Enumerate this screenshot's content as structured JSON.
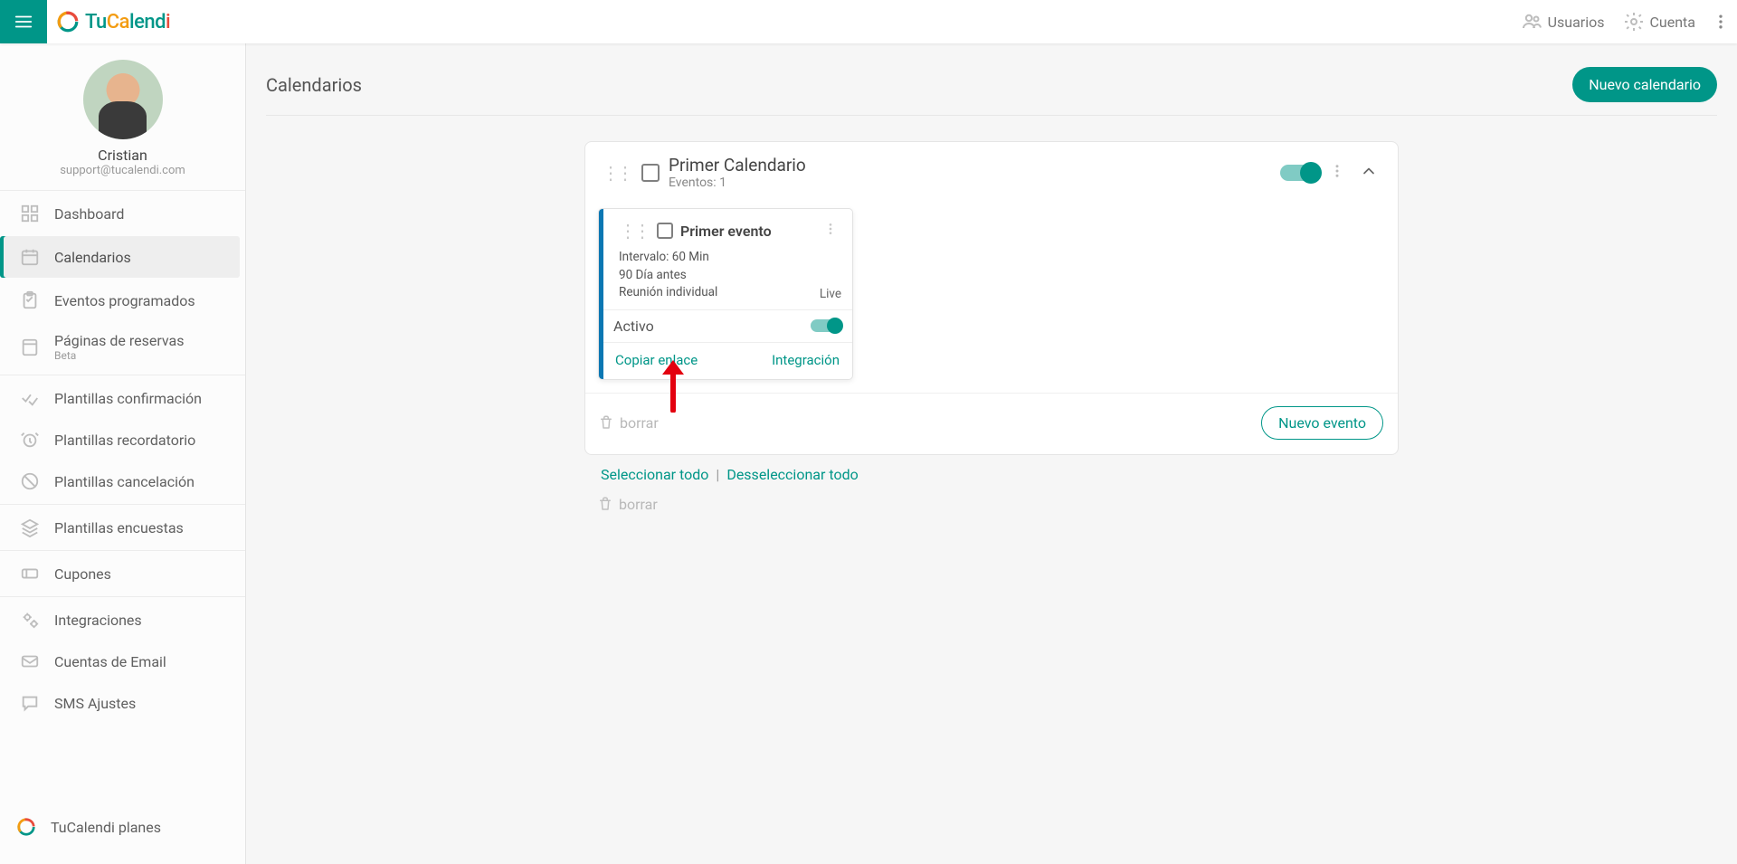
{
  "brand": {
    "p1": "Tu",
    "p2": "Ca",
    "p3": "lend",
    "p4": "i"
  },
  "header": {
    "users": "Usuarios",
    "account": "Cuenta"
  },
  "profile": {
    "name": "Cristian",
    "email": "support@tucalendi.com"
  },
  "sidebar": {
    "items": [
      {
        "id": "dashboard",
        "label": "Dashboard"
      },
      {
        "id": "calendarios",
        "label": "Calendarios"
      },
      {
        "id": "eventos",
        "label": "Eventos programados"
      },
      {
        "id": "reservas",
        "label": "Páginas de reservas",
        "sub": "Beta"
      },
      {
        "id": "tconf",
        "label": "Plantillas confirmación"
      },
      {
        "id": "trec",
        "label": "Plantillas recordatorio"
      },
      {
        "id": "tcan",
        "label": "Plantillas cancelación"
      },
      {
        "id": "tenc",
        "label": "Plantillas encuestas"
      },
      {
        "id": "cupones",
        "label": "Cupones"
      },
      {
        "id": "integr",
        "label": "Integraciones"
      },
      {
        "id": "email",
        "label": "Cuentas de Email"
      },
      {
        "id": "sms",
        "label": "SMS Ajustes"
      }
    ],
    "bottom": {
      "label": "TuCalendi planes"
    }
  },
  "page": {
    "title": "Calendarios",
    "new_btn": "Nuevo calendario",
    "select_all": "Seleccionar todo",
    "deselect_all": "Desseleccionar todo",
    "delete": "borrar"
  },
  "calendar": {
    "title": "Primer Calendario",
    "events_label": "Eventos: 1",
    "delete": "borrar",
    "new_event": "Nuevo evento"
  },
  "event": {
    "title": "Primer evento",
    "interval": "Intervalo: 60 Min",
    "advance": "90 Día antes",
    "meeting_type": "Reunión individual",
    "live": "Live",
    "active_label": "Activo",
    "copy_link": "Copiar enlace",
    "integration": "Integración"
  }
}
